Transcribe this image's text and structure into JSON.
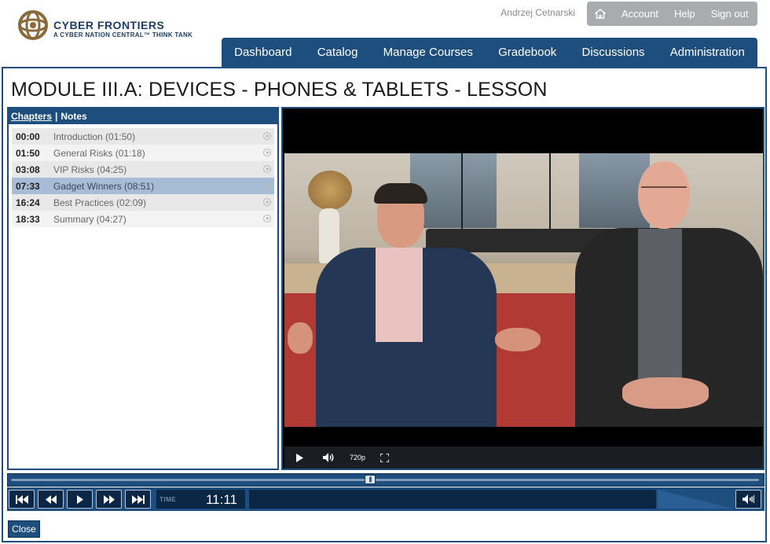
{
  "brand": {
    "title": "CYBER FRONTIERS",
    "subtitle": "A CYBER NATION CENTRAL™ THINK TANK",
    "color": "#1f3e63"
  },
  "user": {
    "name": "Andrzej Cetnarski"
  },
  "utility_nav": {
    "home_icon": "home-icon",
    "items": [
      "Account",
      "Help",
      "Sign out"
    ]
  },
  "main_nav": [
    "Dashboard",
    "Catalog",
    "Manage Courses",
    "Gradebook",
    "Discussions",
    "Administration"
  ],
  "page": {
    "title": "MODULE III.A: DEVICES - PHONES & TABLETS - LESSON"
  },
  "panel": {
    "tab_chapters": "Chapters",
    "separator": "|",
    "tab_notes": "Notes",
    "chapters": [
      {
        "time": "00:00",
        "title": "Introduction (01:50)",
        "active": false
      },
      {
        "time": "01:50",
        "title": "General Risks (01:18)",
        "active": false
      },
      {
        "time": "03:08",
        "title": "VIP Risks (04:25)",
        "active": false
      },
      {
        "time": "07:33",
        "title": "Gadget Winners (08:51)",
        "active": true
      },
      {
        "time": "16:24",
        "title": "Best Practices (02:09)",
        "active": false
      },
      {
        "time": "18:33",
        "title": "Summary (04:27)",
        "active": false
      }
    ]
  },
  "video": {
    "quality": "720p",
    "icons": [
      "play-icon",
      "volume-icon",
      "fullscreen-icon"
    ]
  },
  "player": {
    "time_label": "TIME",
    "time": "11:11",
    "progress": 0.48,
    "icons": [
      "skip-start-icon",
      "rewind-icon",
      "play-icon",
      "fast-forward-icon",
      "skip-end-icon",
      "volume-icon"
    ]
  },
  "close_label": "Close",
  "colors": {
    "primary": "#1d4e7e",
    "dark": "#0c2746",
    "active_row": "#a7bcd6",
    "utility_bg": "#a9acae"
  }
}
